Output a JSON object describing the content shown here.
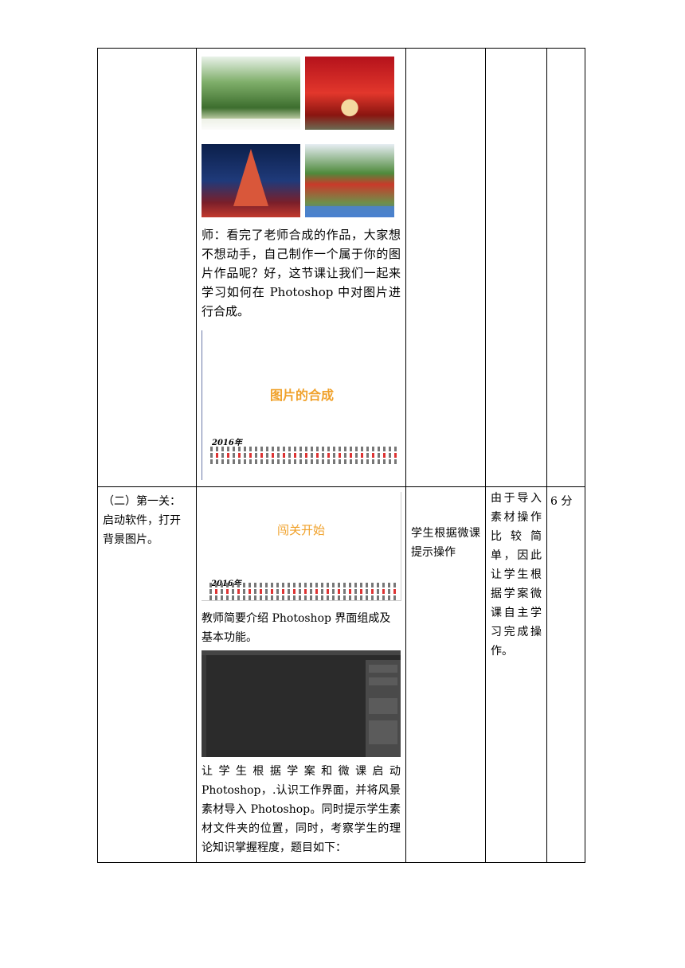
{
  "row1": {
    "images": [
      {
        "name": "palm-garden-calendar-photo"
      },
      {
        "name": "red-flower-path-photo"
      },
      {
        "name": "night-temple-photo"
      },
      {
        "name": "park-pavilion-photo"
      }
    ],
    "teacher_text": "师：看完了老师合成的作品，大家想不想动手，自己制作一个属于你的图片作品呢？好，这节课让我们一起来学习如何在 Photoshop 中对图片进行合成。",
    "slide_title": "图片的合成",
    "slide_year": "2016年"
  },
  "row2": {
    "stage": "（二）第一关：启动软件，打开背景图片。",
    "slide_title": "闯关开始",
    "slide_year": "2016年",
    "intro_text": "教师简要介绍 Photoshop 界面组成及基本功能。",
    "instruction_text": "让学生根据学案和微课启动 Photoshop，.认识工作界面，并将风景素材导入 Photoshop。同时提示学生素材文件夹的位置，同时，考察学生的理论知识掌握程度，题目如下：",
    "student_activity": "学生根据微课提示操作",
    "design_intent": "由于导入素材操作比较简单，因此让学生根据学案微课自主学习完成操作。",
    "time": "6 分"
  }
}
